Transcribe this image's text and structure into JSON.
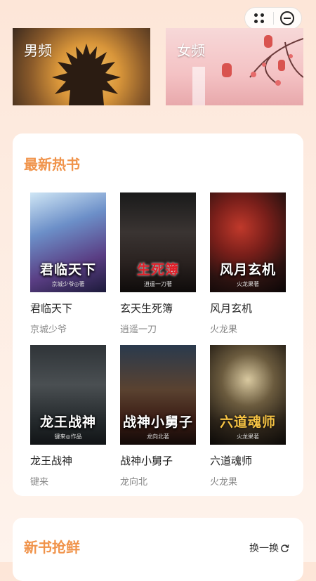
{
  "capsule": {
    "menu_icon": "more-dots-icon",
    "close_icon": "minus-circle-icon"
  },
  "banners": [
    {
      "label": "男频"
    },
    {
      "label": "女频"
    }
  ],
  "hot_section": {
    "title": "最新热书",
    "books": [
      {
        "title": "君临天下",
        "author": "京城少爷",
        "cover_text": "君临天下",
        "cover_sub": "京城少爷◎著"
      },
      {
        "title": "玄天生死簿",
        "author": "逍遥一刀",
        "cover_text": "生死簿",
        "cover_sub": "逍遥一刀著"
      },
      {
        "title": "风月玄机",
        "author": "火龙果",
        "cover_text": "风月玄机",
        "cover_sub": "火龙果著"
      },
      {
        "title": "龙王战神",
        "author": "键来",
        "cover_text": "龙王战神",
        "cover_sub": "键来◎作品"
      },
      {
        "title": "战神小舅子",
        "author": "龙向北",
        "cover_text": "战神小舅子",
        "cover_sub": "龙向北著"
      },
      {
        "title": "六道魂师",
        "author": "火龙果",
        "cover_text": "六道魂师",
        "cover_sub": "火龙果著"
      }
    ]
  },
  "new_section": {
    "title": "新书抢鲜",
    "swap_label": "换一换",
    "swap_icon": "refresh-icon"
  }
}
